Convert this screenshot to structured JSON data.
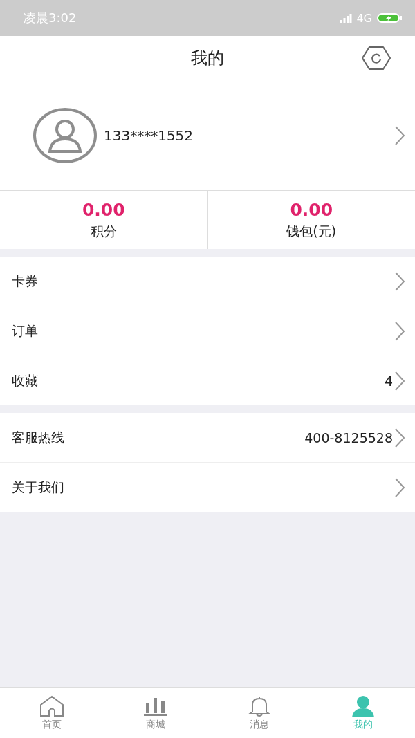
{
  "status_bar": {
    "time": "凌晨3:02",
    "network": "4G"
  },
  "header": {
    "title": "我的"
  },
  "profile": {
    "phone": "133****1552"
  },
  "stats": [
    {
      "value": "0.00",
      "label": "积分"
    },
    {
      "value": "0.00",
      "label": "钱包(元)"
    }
  ],
  "menu_groups": [
    [
      {
        "label": "卡券"
      },
      {
        "label": "订单"
      },
      {
        "label": "收藏",
        "value": "4"
      }
    ],
    [
      {
        "label": "客服热线",
        "value": "400-8125528"
      },
      {
        "label": "关于我们"
      }
    ]
  ],
  "tab_bar": [
    {
      "kind": "home",
      "label": "首页",
      "selected": false
    },
    {
      "kind": "shop",
      "label": "商城",
      "selected": false
    },
    {
      "kind": "bell",
      "label": "消息",
      "selected": false
    },
    {
      "kind": "person",
      "label": "我的",
      "selected": true
    }
  ]
}
